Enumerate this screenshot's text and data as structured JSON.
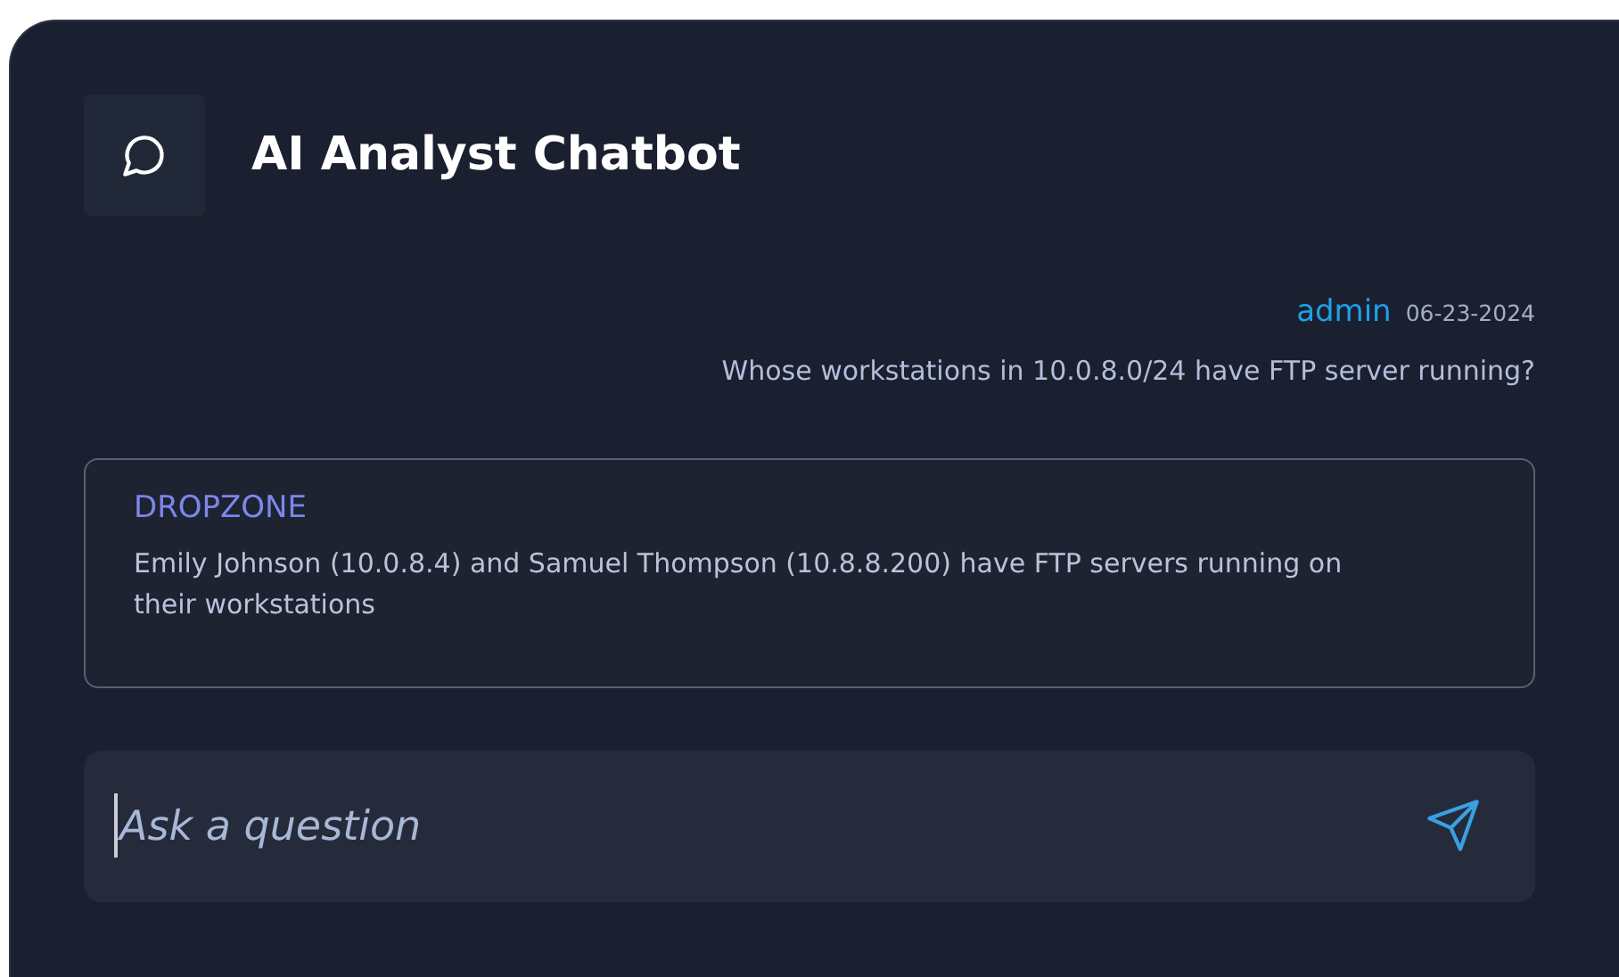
{
  "header": {
    "title": "AI Analyst Chatbot"
  },
  "messages": [
    {
      "kind": "user",
      "sender": "admin",
      "date": "06-23-2024",
      "text": "Whose workstations in 10.0.8.0/24 have FTP server running?"
    },
    {
      "kind": "bot",
      "sender": "DROPZONE",
      "text": "Emily Johnson (10.0.8.4) and Samuel Thompson (10.8.8.200) have FTP servers running on their workstations"
    }
  ],
  "composer": {
    "placeholder": "Ask a question"
  }
}
